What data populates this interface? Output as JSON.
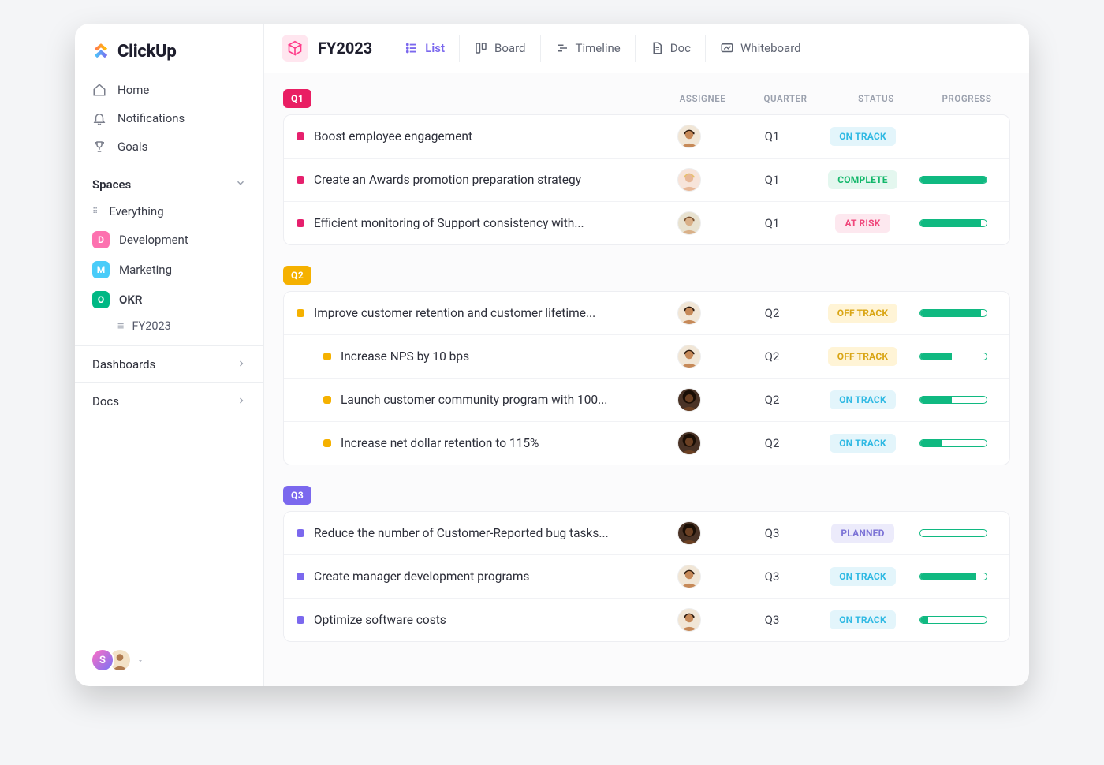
{
  "brand": {
    "name": "ClickUp"
  },
  "nav": {
    "items": [
      {
        "label": "Home",
        "icon": "home-icon"
      },
      {
        "label": "Notifications",
        "icon": "bell-icon"
      },
      {
        "label": "Goals",
        "icon": "trophy-icon"
      }
    ]
  },
  "spaces": {
    "header": "Spaces",
    "everything_label": "Everything",
    "items": [
      {
        "label": "Development",
        "badge": "D",
        "color": "#fd71af"
      },
      {
        "label": "Marketing",
        "badge": "M",
        "color": "#49ccf9"
      },
      {
        "label": "OKR",
        "badge": "O",
        "color": "#00b884",
        "active": true,
        "children": [
          {
            "label": "FY2023"
          }
        ]
      }
    ]
  },
  "side_sections": {
    "dashboards": "Dashboards",
    "docs": "Docs"
  },
  "workspace_switcher": {
    "initial": "S"
  },
  "header": {
    "title": "FY2023",
    "tabs": [
      {
        "label": "List",
        "icon": "list-icon",
        "active": true
      },
      {
        "label": "Board",
        "icon": "board-icon"
      },
      {
        "label": "Timeline",
        "icon": "timeline-icon"
      },
      {
        "label": "Doc",
        "icon": "doc-icon"
      },
      {
        "label": "Whiteboard",
        "icon": "whiteboard-icon"
      }
    ]
  },
  "columns": {
    "assignee": "ASSIGNEE",
    "quarter": "QUARTER",
    "status": "STATUS",
    "progress": "PROGRESS"
  },
  "status_styles": {
    "ON TRACK": {
      "bg": "#e3f5fb",
      "fg": "#2fb9e3"
    },
    "COMPLETE": {
      "bg": "#e4f7ef",
      "fg": "#12b76a"
    },
    "AT RISK": {
      "bg": "#fde8ef",
      "fg": "#f0477b"
    },
    "OFF TRACK": {
      "bg": "#fff4d6",
      "fg": "#d9a514"
    },
    "PLANNED": {
      "bg": "#ecebfb",
      "fg": "#7b72d6"
    }
  },
  "groups": [
    {
      "tag": "Q1",
      "tag_color": "#e91e63",
      "bullet_color": "#e6206d",
      "tasks": [
        {
          "name": "Boost employee engagement",
          "assignee_variant": "a",
          "quarter": "Q1",
          "status": "ON TRACK",
          "progress": null,
          "indent": 0
        },
        {
          "name": "Create an Awards promotion preparation strategy",
          "assignee_variant": "b",
          "quarter": "Q1",
          "status": "COMPLETE",
          "progress": 100,
          "indent": 0
        },
        {
          "name": "Efficient monitoring of Support consistency with...",
          "assignee_variant": "c",
          "quarter": "Q1",
          "status": "AT RISK",
          "progress": 92,
          "indent": 0
        }
      ]
    },
    {
      "tag": "Q2",
      "tag_color": "#f5b100",
      "bullet_color": "#f5b100",
      "tasks": [
        {
          "name": "Improve customer retention and customer lifetime...",
          "assignee_variant": "a",
          "quarter": "Q2",
          "status": "OFF TRACK",
          "progress": 92,
          "indent": 0
        },
        {
          "name": "Increase NPS by 10 bps",
          "assignee_variant": "a",
          "quarter": "Q2",
          "status": "OFF TRACK",
          "progress": 48,
          "indent": 1
        },
        {
          "name": "Launch customer community program with 100...",
          "assignee_variant": "d",
          "quarter": "Q2",
          "status": "ON TRACK",
          "progress": 48,
          "indent": 1
        },
        {
          "name": "Increase net dollar retention to 115%",
          "assignee_variant": "d",
          "quarter": "Q2",
          "status": "ON TRACK",
          "progress": 32,
          "indent": 1
        }
      ]
    },
    {
      "tag": "Q3",
      "tag_color": "#7b68ee",
      "bullet_color": "#7b68ee",
      "tasks": [
        {
          "name": "Reduce the number of Customer-Reported bug tasks...",
          "assignee_variant": "d",
          "quarter": "Q3",
          "status": "PLANNED",
          "progress": 0,
          "indent": 0
        },
        {
          "name": "Create manager development programs",
          "assignee_variant": "a",
          "quarter": "Q3",
          "status": "ON TRACK",
          "progress": 85,
          "indent": 0
        },
        {
          "name": "Optimize software costs",
          "assignee_variant": "a",
          "quarter": "Q3",
          "status": "ON TRACK",
          "progress": 12,
          "indent": 0
        }
      ]
    }
  ]
}
